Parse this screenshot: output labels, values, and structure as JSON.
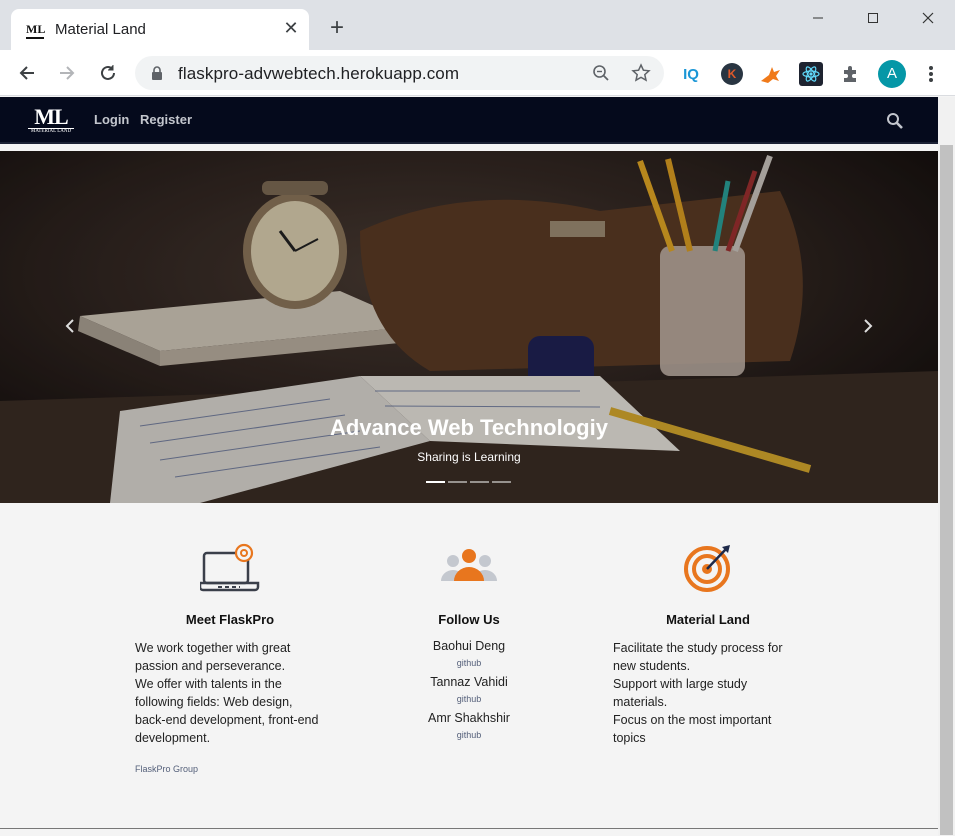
{
  "browser": {
    "tab_title": "Material Land",
    "tab_favicon_text": "ML",
    "url": "flaskpro-advwebtech.herokuapp.com",
    "tab_close": "✕",
    "new_tab": "+",
    "extensions": [
      {
        "name": "iq-extension",
        "text": "IQ",
        "color": "#1a96d6"
      },
      {
        "name": "k-extension",
        "text": "K",
        "color": "#e0592a"
      },
      {
        "name": "fox-extension",
        "text": "",
        "color": "#f07a1a"
      },
      {
        "name": "react-devtools-extension",
        "text": "",
        "color": "#61dafb"
      },
      {
        "name": "extensions-puzzle",
        "text": "",
        "color": "#5f6368"
      }
    ],
    "profile_initial": "A",
    "profile_color": "#0597a7"
  },
  "site": {
    "logo_big": "ML",
    "logo_small": "MATERIAL LAND",
    "nav_login": "Login",
    "nav_register": "Register"
  },
  "carousel": {
    "title": "Advance Web Technologiy",
    "subtitle": "Sharing is Learning",
    "slide_count": 4,
    "active_index": 0
  },
  "features": {
    "meet": {
      "title": "Meet FlaskPro",
      "lines": [
        "We work together with great",
        "passion and perseverance.",
        "We offer with talents in the",
        "following fields: Web design,",
        "back-end development, front-end",
        "development."
      ],
      "group": "FlaskPro Group"
    },
    "follow": {
      "title": "Follow Us",
      "people": [
        {
          "name": "Baohui Deng",
          "link": "github"
        },
        {
          "name": "Tannaz Vahidi",
          "link": "github"
        },
        {
          "name": "Amr Shakhshir",
          "link": "github"
        }
      ]
    },
    "material": {
      "title": "Material Land",
      "lines": [
        "Facilitate the study process for",
        "new students.",
        "Support with large study",
        "materials.",
        "Focus on the most important",
        "topics"
      ]
    }
  },
  "colors": {
    "nav_bg": "#050a1c",
    "accent_orange": "#e8761e",
    "icon_dark": "#3a3f4a"
  }
}
